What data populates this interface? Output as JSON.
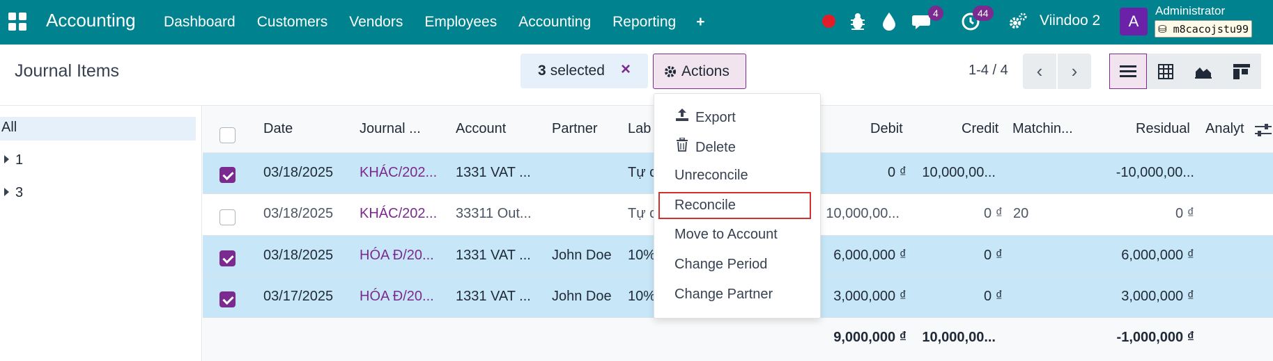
{
  "navbar": {
    "app_name": "Accounting",
    "menu": [
      "Dashboard",
      "Customers",
      "Vendors",
      "Employees",
      "Accounting",
      "Reporting"
    ],
    "plus_label": "+",
    "messages_count": "4",
    "activity_count": "44",
    "company": "Viindoo 2",
    "avatar_letter": "A",
    "user_name": "Administrator",
    "database": "m8cacojstu99",
    "colors": {
      "bar": "#00838f",
      "badge": "#7b2a8f",
      "record": "#e11d2a"
    }
  },
  "control_panel": {
    "title": "Journal Items",
    "selected_count": "3",
    "selected_label": "selected",
    "clear_selection": "×",
    "actions_label": "Actions",
    "pager": "1-4 / 4"
  },
  "actions_menu": {
    "items": [
      "Export",
      "Delete",
      "Unreconcile",
      "Reconcile",
      "Move to Account",
      "Change Period",
      "Change Partner"
    ],
    "highlighted": "Reconcile"
  },
  "sidebar": {
    "all_label": "All",
    "groups": [
      "1",
      "3"
    ]
  },
  "table": {
    "columns": [
      "Date",
      "Journal ...",
      "Account",
      "Partner",
      "Lab",
      "Debit",
      "Credit",
      "Matchin...",
      "Residual",
      "Analyt"
    ],
    "rows": [
      {
        "selected": true,
        "date": "03/18/2025",
        "journal": "KHÁC/202...",
        "account": "1331 VAT ...",
        "partner": "",
        "label": "Tự c",
        "debit": "0 ₫",
        "credit": "10,000,00...",
        "matching": "",
        "residual": "-10,000,00..."
      },
      {
        "selected": false,
        "date": "03/18/2025",
        "journal": "KHÁC/202...",
        "account": "33311 Out...",
        "partner": "",
        "label": "Tự c",
        "debit": "10,000,00...",
        "credit": "0 ₫",
        "matching": "20",
        "residual": "0 ₫"
      },
      {
        "selected": true,
        "date": "03/18/2025",
        "journal": "HÓA Đ/20...",
        "account": "1331 VAT ...",
        "partner": "John Doe",
        "label": "10%",
        "debit": "6,000,000 ₫",
        "credit": "0 ₫",
        "matching": "",
        "residual": "6,000,000 ₫"
      },
      {
        "selected": true,
        "date": "03/17/2025",
        "journal": "HÓA Đ/20...",
        "account": "1331 VAT ...",
        "partner": "John Doe",
        "label": "10%",
        "debit": "3,000,000 ₫",
        "credit": "0 ₫",
        "matching": "",
        "residual": "3,000,000 ₫"
      }
    ],
    "totals": {
      "debit": "9,000,000 ₫",
      "credit": "10,000,00...",
      "residual": "-1,000,000 ₫"
    }
  }
}
